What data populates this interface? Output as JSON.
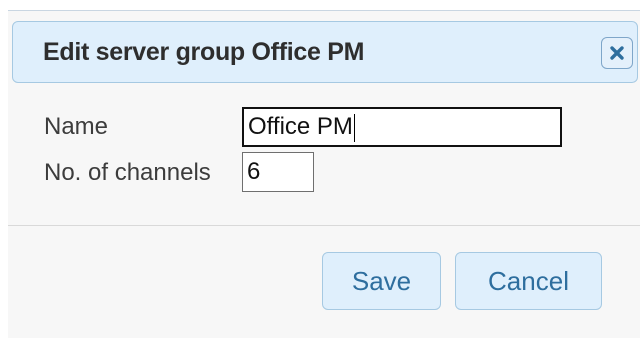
{
  "dialog": {
    "title": "Edit server group Office PM",
    "close_icon": "close-x-icon",
    "fields": {
      "name_label": "Name",
      "name_value": "Office PM",
      "channels_label": "No. of channels",
      "channels_value": "6"
    },
    "buttons": {
      "save_label": "Save",
      "cancel_label": "Cancel"
    }
  },
  "colors": {
    "titlebar_bg": "#dfeffc",
    "titlebar_border": "#a6c9e2",
    "button_text": "#2e6e9e",
    "dialog_bg": "#f7f7f7"
  }
}
